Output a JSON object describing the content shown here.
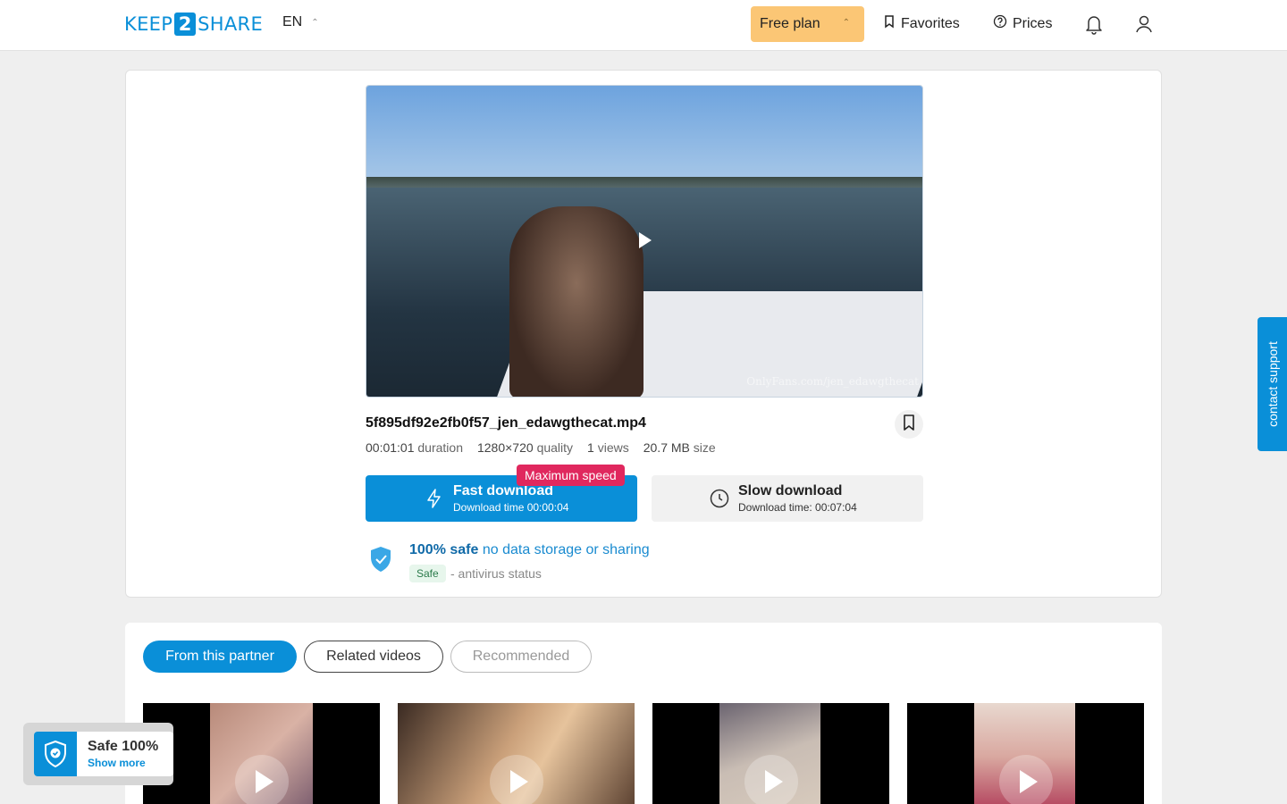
{
  "header": {
    "logo_left": "KEEP",
    "logo_mid": "2",
    "logo_right": "SHARE",
    "lang": "EN",
    "plan": "Free plan",
    "favorites": "Favorites",
    "prices": "Prices"
  },
  "file": {
    "name": "5f895df92e2fb0f57_jen_edawgthecat.mp4",
    "watermark": "OnlyFans.com/jen_edawgthecat",
    "duration": "00:01:01",
    "duration_label": "duration",
    "quality": "1280×720",
    "quality_label": "quality",
    "views": "1",
    "views_label": "views",
    "size": "20.7 MB",
    "size_label": "size"
  },
  "download": {
    "max_badge": "Maximum speed",
    "fast_title": "Fast download",
    "fast_sub": "Download time 00:00:04",
    "slow_title": "Slow download",
    "slow_sub": "Download time: 00:07:04"
  },
  "safety": {
    "strong": "100% safe",
    "text": "no data storage or sharing",
    "badge": "Safe",
    "status": "- antivirus status"
  },
  "tabs": {
    "partner": "From this partner",
    "related": "Related videos",
    "recommended": "Recommended"
  },
  "support": "contact support",
  "widget": {
    "title": "Safe 100%",
    "link": "Show more"
  },
  "colors": {
    "brand": "#0a8fd8",
    "plan": "#fbc675",
    "badge": "#e0285e"
  }
}
